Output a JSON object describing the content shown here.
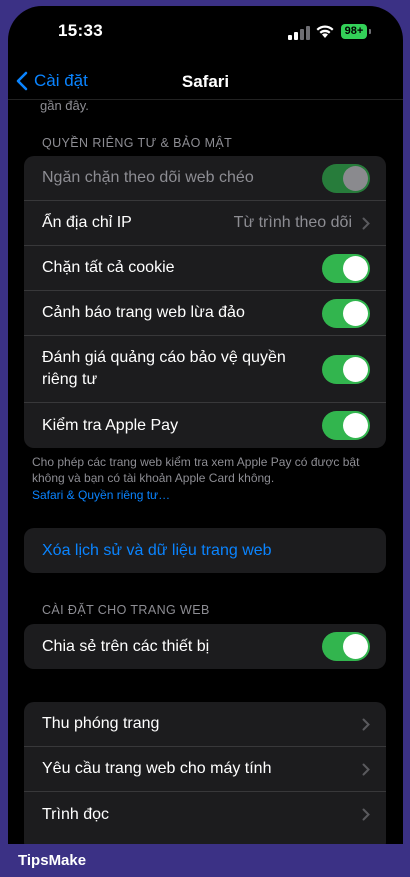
{
  "status_bar": {
    "time": "15:33",
    "battery": "98+"
  },
  "nav": {
    "back_label": "Cài đặt",
    "title": "Safari"
  },
  "top_note": "gần đây.",
  "privacy_section": {
    "header": "QUYỀN RIÊNG TƯ & BẢO MẬT",
    "items": [
      {
        "label": "Ngăn chặn theo dõi web chéo",
        "type": "toggle",
        "on": true,
        "disabled": true
      },
      {
        "label": "Ẩn địa chỉ IP",
        "type": "link",
        "value": "Từ trình theo dõi"
      },
      {
        "label": "Chặn tất cả cookie",
        "type": "toggle",
        "on": true
      },
      {
        "label": "Cảnh báo trang web lừa đảo",
        "type": "toggle",
        "on": true
      },
      {
        "label": "Đánh giá quảng cáo bảo vệ quyền riêng tư",
        "type": "toggle",
        "on": true
      },
      {
        "label": "Kiểm tra Apple Pay",
        "type": "toggle",
        "on": true
      }
    ],
    "footer": "Cho phép các trang web kiểm tra xem Apple Pay có được bật không và bạn có tài khoản Apple Card không.",
    "footer_link": "Safari & Quyền riêng tư…"
  },
  "clear_history": {
    "label": "Xóa lịch sử và dữ liệu trang web"
  },
  "website_section": {
    "header": "CÀI ĐẶT CHO TRANG WEB",
    "items": [
      {
        "label": "Chia sẻ trên các thiết bị",
        "type": "toggle",
        "on": true
      }
    ]
  },
  "more_section": {
    "items": [
      {
        "label": "Thu phóng trang"
      },
      {
        "label": "Yêu cầu trang web cho máy tính"
      },
      {
        "label": "Trình đọc"
      }
    ]
  },
  "colors": {
    "accent": "#0a84ff",
    "toggle_on": "#32b54e",
    "group_bg": "#1c1c1e",
    "frame": "#3b3185"
  },
  "watermark": "TipsMake"
}
